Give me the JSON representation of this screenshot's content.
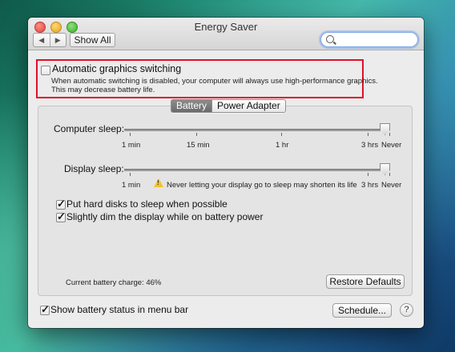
{
  "window": {
    "title": "Energy Saver"
  },
  "toolbar": {
    "back": "◀",
    "forward": "▶",
    "show_all": "Show All",
    "search_placeholder": ""
  },
  "auto_graphics": {
    "label": "Automatic graphics switching",
    "checked": false,
    "desc_line1": "When automatic switching is disabled, your computer will always use high-performance graphics.",
    "desc_line2": "This may decrease battery life."
  },
  "tabs": [
    {
      "label": "Battery",
      "active": true
    },
    {
      "label": "Power Adapter",
      "active": false
    }
  ],
  "computer_sleep": {
    "label": "Computer sleep:",
    "ticks": [
      "1 min",
      "15 min",
      "1 hr",
      "3 hrs",
      "Never"
    ],
    "value": "Never"
  },
  "display_sleep": {
    "label": "Display sleep:",
    "ticks": [
      "1 min",
      "3 hrs",
      "Never"
    ],
    "warning": "Never letting your display go to sleep may shorten its life",
    "value": "Never"
  },
  "options": [
    {
      "label": "Put hard disks to sleep when possible",
      "checked": true
    },
    {
      "label": "Slightly dim the display while on battery power",
      "checked": true
    }
  ],
  "battery_charge": "Current battery charge: 46%",
  "restore_defaults": "Restore Defaults",
  "show_status": {
    "label": "Show battery status in menu bar",
    "checked": true
  },
  "schedule": "Schedule...",
  "help": "?"
}
